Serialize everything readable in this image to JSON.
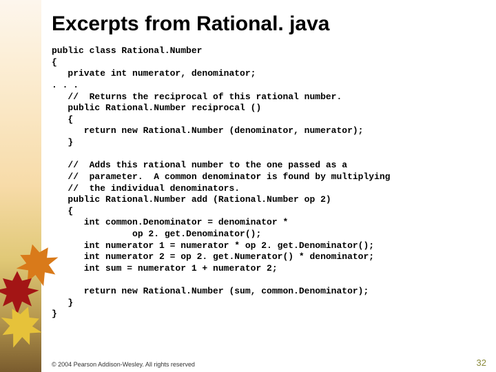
{
  "title": "Excerpts from Rational. java",
  "code": "public class Rational.Number\n{\n   private int numerator, denominator;\n. . .\n   //  Returns the reciprocal of this rational number.\n   public Rational.Number reciprocal ()\n   {\n      return new Rational.Number (denominator, numerator);\n   }\n\n   //  Adds this rational number to the one passed as a\n   //  parameter.  A common denominator is found by multiplying\n   //  the individual denominators.\n   public Rational.Number add (Rational.Number op 2)\n   {\n      int common.Denominator = denominator *\n               op 2. get.Denominator();\n      int numerator 1 = numerator * op 2. get.Denominator();\n      int numerator 2 = op 2. get.Numerator() * denominator;\n      int sum = numerator 1 + numerator 2;\n\n      return new Rational.Number (sum, common.Denominator);\n   }\n}",
  "copyright": "© 2004 Pearson Addison-Wesley. All rights reserved",
  "page_number": "32"
}
